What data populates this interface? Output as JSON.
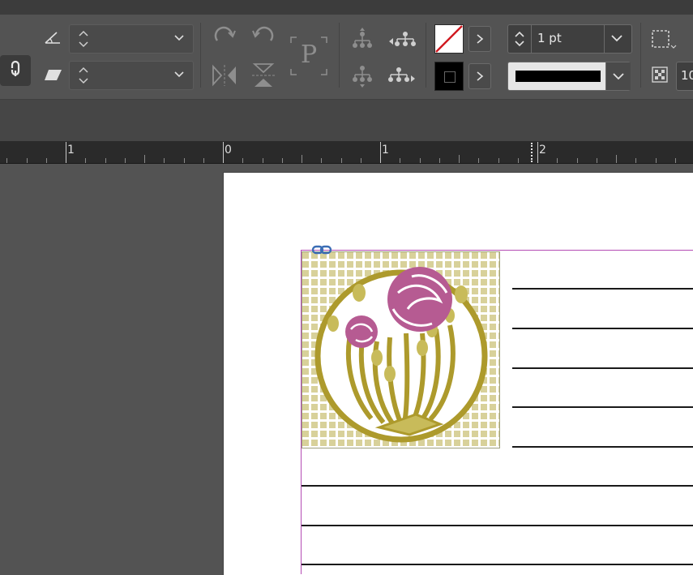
{
  "control_panel": {
    "link_icon": "chain-link-icon",
    "rotation_field": {
      "icon": "rotate-angle-icon",
      "value": ""
    },
    "shear_field": {
      "icon": "shear-icon",
      "value": ""
    },
    "rotate_cw_icon": "rotate-clockwise-icon",
    "rotate_ccw_icon": "rotate-counterclockwise-icon",
    "flip_horizontal_icon": "flip-horizontal-icon",
    "flip_vertical_icon": "flip-vertical-icon",
    "text_frame_icon_glyph": "P",
    "select_container_icon": "select-container-icon",
    "select_content_icon": "select-content-icon",
    "select_previous_icon": "select-previous-object-icon",
    "select_next_icon": "select-next-object-icon",
    "fill_swatch": {
      "name": "None",
      "color": "#ffffff",
      "slash_color": "#d0181f"
    },
    "stroke_swatch": {
      "name": "Black",
      "color": "#000000"
    },
    "stroke_weight": "1 pt",
    "stroke_type_color": "#000000",
    "frame_fitting_icon": "frame-fitting-icon",
    "opacity_value": "10"
  },
  "ruler": {
    "labels": [
      "1",
      "0",
      "1",
      "2"
    ]
  },
  "artwork": {
    "grid_color": "#d8d19a",
    "gold": "#ad9a2c",
    "pink": "#b65b92",
    "light_gold": "#c8bb5a"
  },
  "colors": {
    "margin_guide": "#b34bb3",
    "page": "#ffffff",
    "pasteboard": "#535353"
  }
}
